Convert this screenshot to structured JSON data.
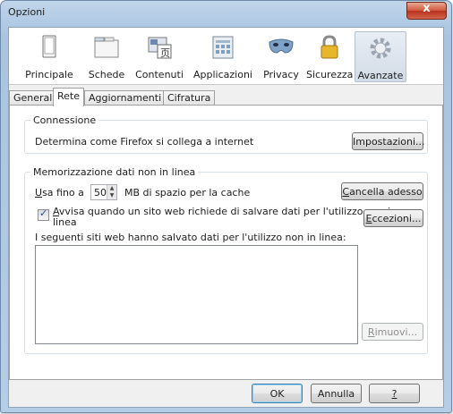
{
  "window": {
    "title": "Opzioni",
    "close_glyph": "x"
  },
  "toolbar": {
    "panes": [
      {
        "label": "Principale",
        "icon": "general-window-icon"
      },
      {
        "label": "Schede",
        "icon": "tabs-icon"
      },
      {
        "label": "Contenuti",
        "icon": "content-icon"
      },
      {
        "label": "Applicazioni",
        "icon": "applications-icon"
      },
      {
        "label": "Privacy",
        "icon": "privacy-mask-icon"
      },
      {
        "label": "Sicurezza",
        "icon": "security-lock-icon"
      },
      {
        "label": "Avanzate",
        "icon": "advanced-gear-icon",
        "selected": true
      }
    ]
  },
  "tabs": [
    {
      "label": "Generale"
    },
    {
      "label": "Rete",
      "active": true
    },
    {
      "label": "Aggiornamenti"
    },
    {
      "label": "Cifratura"
    }
  ],
  "connection": {
    "legend": "Connessione",
    "description": "Determina come Firefox si collega a internet",
    "settings_button": "Impostazioni..."
  },
  "offline": {
    "legend": "Memorizzazione dati non in linea",
    "use_up_to_prefix": "U",
    "use_up_to_rest": "sa fino a",
    "cache_value": "50",
    "cache_suffix": "MB di spazio per la cache",
    "clear_now_button_u": "C",
    "clear_now_button_rest": "ancella adesso",
    "warn_checkbox_u": "A",
    "warn_checkbox_line1": "vvisa quando un sito web richiede di salvare dati per l'utilizzo non in",
    "warn_checkbox_line2": "linea",
    "warn_checked": true,
    "exceptions_button_u": "E",
    "exceptions_button_rest": "ccezioni...",
    "sites_label": "I seguenti siti web hanno salvato dati per l'utilizzo non in linea:",
    "remove_button_u": "R",
    "remove_button_rest": "imuovi..."
  },
  "footer": {
    "ok": "OK",
    "cancel": "Annulla",
    "help": "?"
  },
  "colors": {
    "accent": "#3c7fb1",
    "close": "#c94a31"
  }
}
